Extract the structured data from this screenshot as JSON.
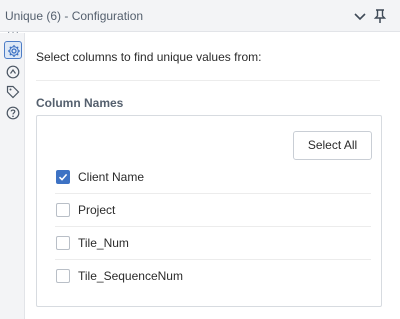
{
  "window": {
    "title": "Unique (6) - Configuration",
    "menu_icon": "chevron-down-icon",
    "pin_icon": "pin-icon"
  },
  "sidebar": {
    "overflow_icon": "ellipsis-icon",
    "items": [
      {
        "icon": "gear-icon",
        "active": true
      },
      {
        "icon": "connections-icon",
        "active": false
      },
      {
        "icon": "tag-icon",
        "active": false
      },
      {
        "icon": "help-icon",
        "active": false
      }
    ]
  },
  "main": {
    "instruction": "Select columns to find unique values from:",
    "section_label": "Column Names",
    "select_all_label": "Select All",
    "columns": [
      {
        "label": "Client Name",
        "checked": true
      },
      {
        "label": "Project",
        "checked": false
      },
      {
        "label": "Tile_Num",
        "checked": false
      },
      {
        "label": "Tile_SequenceNum",
        "checked": false
      }
    ]
  },
  "colors": {
    "accent": "#3d72c4",
    "header_bg": "#f3f4f6",
    "text": "#2b2b2b",
    "muted_text": "#55606e"
  }
}
